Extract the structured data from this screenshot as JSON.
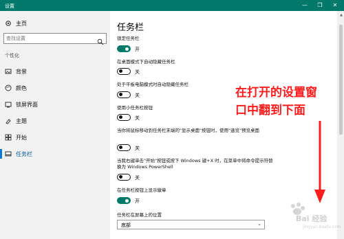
{
  "window": {
    "title": "设置"
  },
  "sidebar": {
    "home_label": "主页",
    "search_placeholder": "查找设置",
    "section_title": "个性化",
    "items": [
      {
        "label": "背景",
        "icon": "image-icon"
      },
      {
        "label": "颜色",
        "icon": "palette-icon"
      },
      {
        "label": "锁屏界面",
        "icon": "lock-screen-icon"
      },
      {
        "label": "主题",
        "icon": "theme-icon"
      },
      {
        "label": "开始",
        "icon": "start-icon"
      },
      {
        "label": "任务栏",
        "icon": "taskbar-icon",
        "active": true
      }
    ]
  },
  "main": {
    "title": "任务栏",
    "settings": [
      {
        "label": "锁定任务栏",
        "state": "开",
        "on": true
      },
      {
        "label": "在桌面模式下自动隐藏任务栏",
        "state": "关",
        "on": false
      },
      {
        "label": "处于平板电脑模式时自动隐藏任务栏",
        "state": "关",
        "on": false
      },
      {
        "label": "使用小任务栏按钮",
        "state": "关",
        "on": false
      },
      {
        "label": "当你将鼠标移动到任务栏末端的\"显示桌面\"按钮时，使用\"速览\"预览桌面",
        "state": "关",
        "on": false
      },
      {
        "label": "当我右键单击\"开始\"按钮或按下 Windows 键+X 时，在菜单中将命令提示符替换为 Windows PowerShell",
        "state": "关",
        "on": false
      },
      {
        "label": "在任务栏按钮上显示徽章",
        "state": "开",
        "on": true
      }
    ],
    "position_label": "任务栏在屏幕上的位置",
    "position_value": "底部"
  },
  "annotation": {
    "line1": "在打开的设置窗",
    "line2": "口中翻到下面"
  },
  "watermark": {
    "text": "Bai 经验",
    "sub": "jingyan.baidu.com"
  },
  "colors": {
    "accent": "#00796b",
    "annotation": "#ff1d1d"
  }
}
